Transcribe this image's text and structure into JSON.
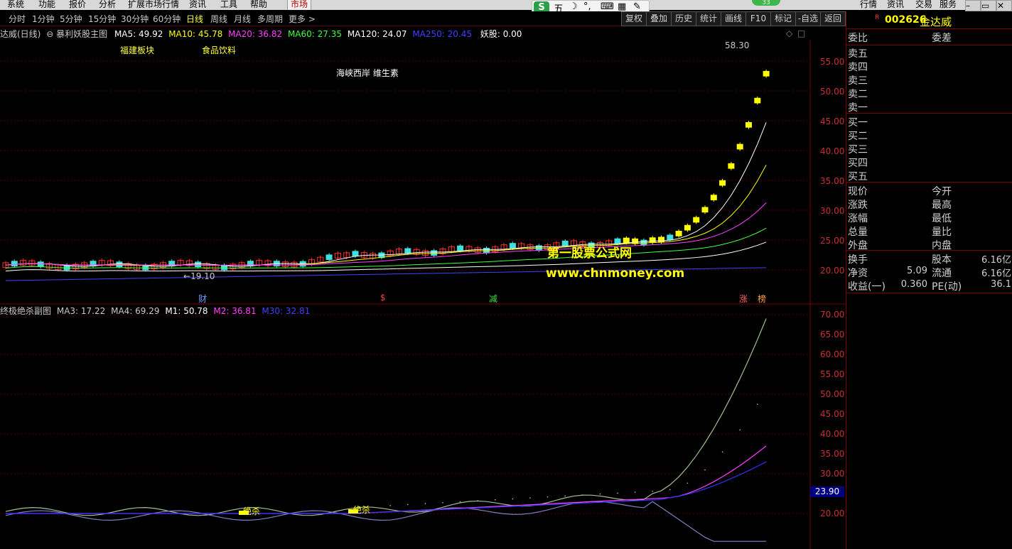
{
  "menu": {
    "items": [
      "系统",
      "功能",
      "报价",
      "分析",
      "扩展市场行情",
      "资讯",
      "工具",
      "帮助"
    ],
    "active": "市场"
  },
  "top_right": [
    "行情",
    "资讯",
    "交易",
    "服务"
  ],
  "periods": [
    "分时",
    "1分钟",
    "5分钟",
    "15分钟",
    "30分钟",
    "60分钟",
    "日线",
    "周线",
    "月线",
    "多周期",
    "更多 >"
  ],
  "selected_period": "日线",
  "toolbar": [
    "复权",
    "叠加",
    "历史",
    "统计",
    "画线",
    "F10",
    "标记",
    "-自选",
    "返回"
  ],
  "ime": {
    "label": "五",
    "badge": "33"
  },
  "main_info": {
    "stock": "达威(日线)",
    "indicator": "暴利妖股主图",
    "ma5": "MA5: 49.92",
    "ma10": "MA10: 45.78",
    "ma20": "MA20: 36.82",
    "ma60": "MA60: 27.35",
    "ma120": "MA120: 24.07",
    "ma250": "MA250: 20.45",
    "yg": "妖股: 0.00"
  },
  "annotations": {
    "sector1": "福建板块",
    "sector2": "食品饮料",
    "concept": "海峡西岸 维生素",
    "high": "58.30",
    "low": "19.10"
  },
  "price_axis": [
    "55.00",
    "50.00",
    "45.00",
    "40.00",
    "35.00",
    "30.00",
    "25.00",
    "20.00"
  ],
  "events": [
    "财",
    "$",
    "减",
    "涨",
    "榜"
  ],
  "watermark": {
    "title": "第一股票公式网",
    "url": "www.chnmoney.com"
  },
  "sub_info": {
    "name": "终极绝杀副图",
    "ma3": "MA3: 17.22",
    "ma4": "MA4: 69.29",
    "m1": "M1: 50.78",
    "m2": "M2: 36.81",
    "m30": "M30: 32.81"
  },
  "sub_axis": [
    "70.00",
    "65.00",
    "60.00",
    "55.00",
    "50.00",
    "45.00",
    "40.00",
    "35.00",
    "30.00",
    "25.00",
    "20.00"
  ],
  "sub_highlight": "23.90",
  "sub_labels": [
    "绝杀",
    "绝杀"
  ],
  "quote": {
    "badge": "R",
    "code": "002626",
    "name": "金达威",
    "head": [
      "委比",
      "委差"
    ],
    "sell": [
      "卖五",
      "卖四",
      "卖三",
      "卖二",
      "卖一"
    ],
    "buy": [
      "买一",
      "买二",
      "买三",
      "买四",
      "买五"
    ],
    "stats_left": [
      "现价",
      "涨跌",
      "涨幅",
      "总量",
      "外盘"
    ],
    "stats_right": [
      "今开",
      "最高",
      "最低",
      "量比",
      "内盘"
    ],
    "fin": [
      {
        "l": "换手",
        "lv": "",
        "r": "股本",
        "rv": "6.16亿"
      },
      {
        "l": "净资",
        "lv": "5.09",
        "r": "流通",
        "rv": "6.16亿"
      },
      {
        "l": "收益(一)",
        "lv": "0.360",
        "r": "PE(动)",
        "rv": "36.1"
      }
    ]
  },
  "colors": {
    "ma5": "#ffffff",
    "ma10": "#ffff00",
    "ma20": "#ff40ff",
    "ma60": "#40ff40",
    "ma120": "#ffffff",
    "ma250": "#4040ff",
    "up": "#ffff00",
    "down": "#40e0e0",
    "axis": "#c83030"
  }
}
